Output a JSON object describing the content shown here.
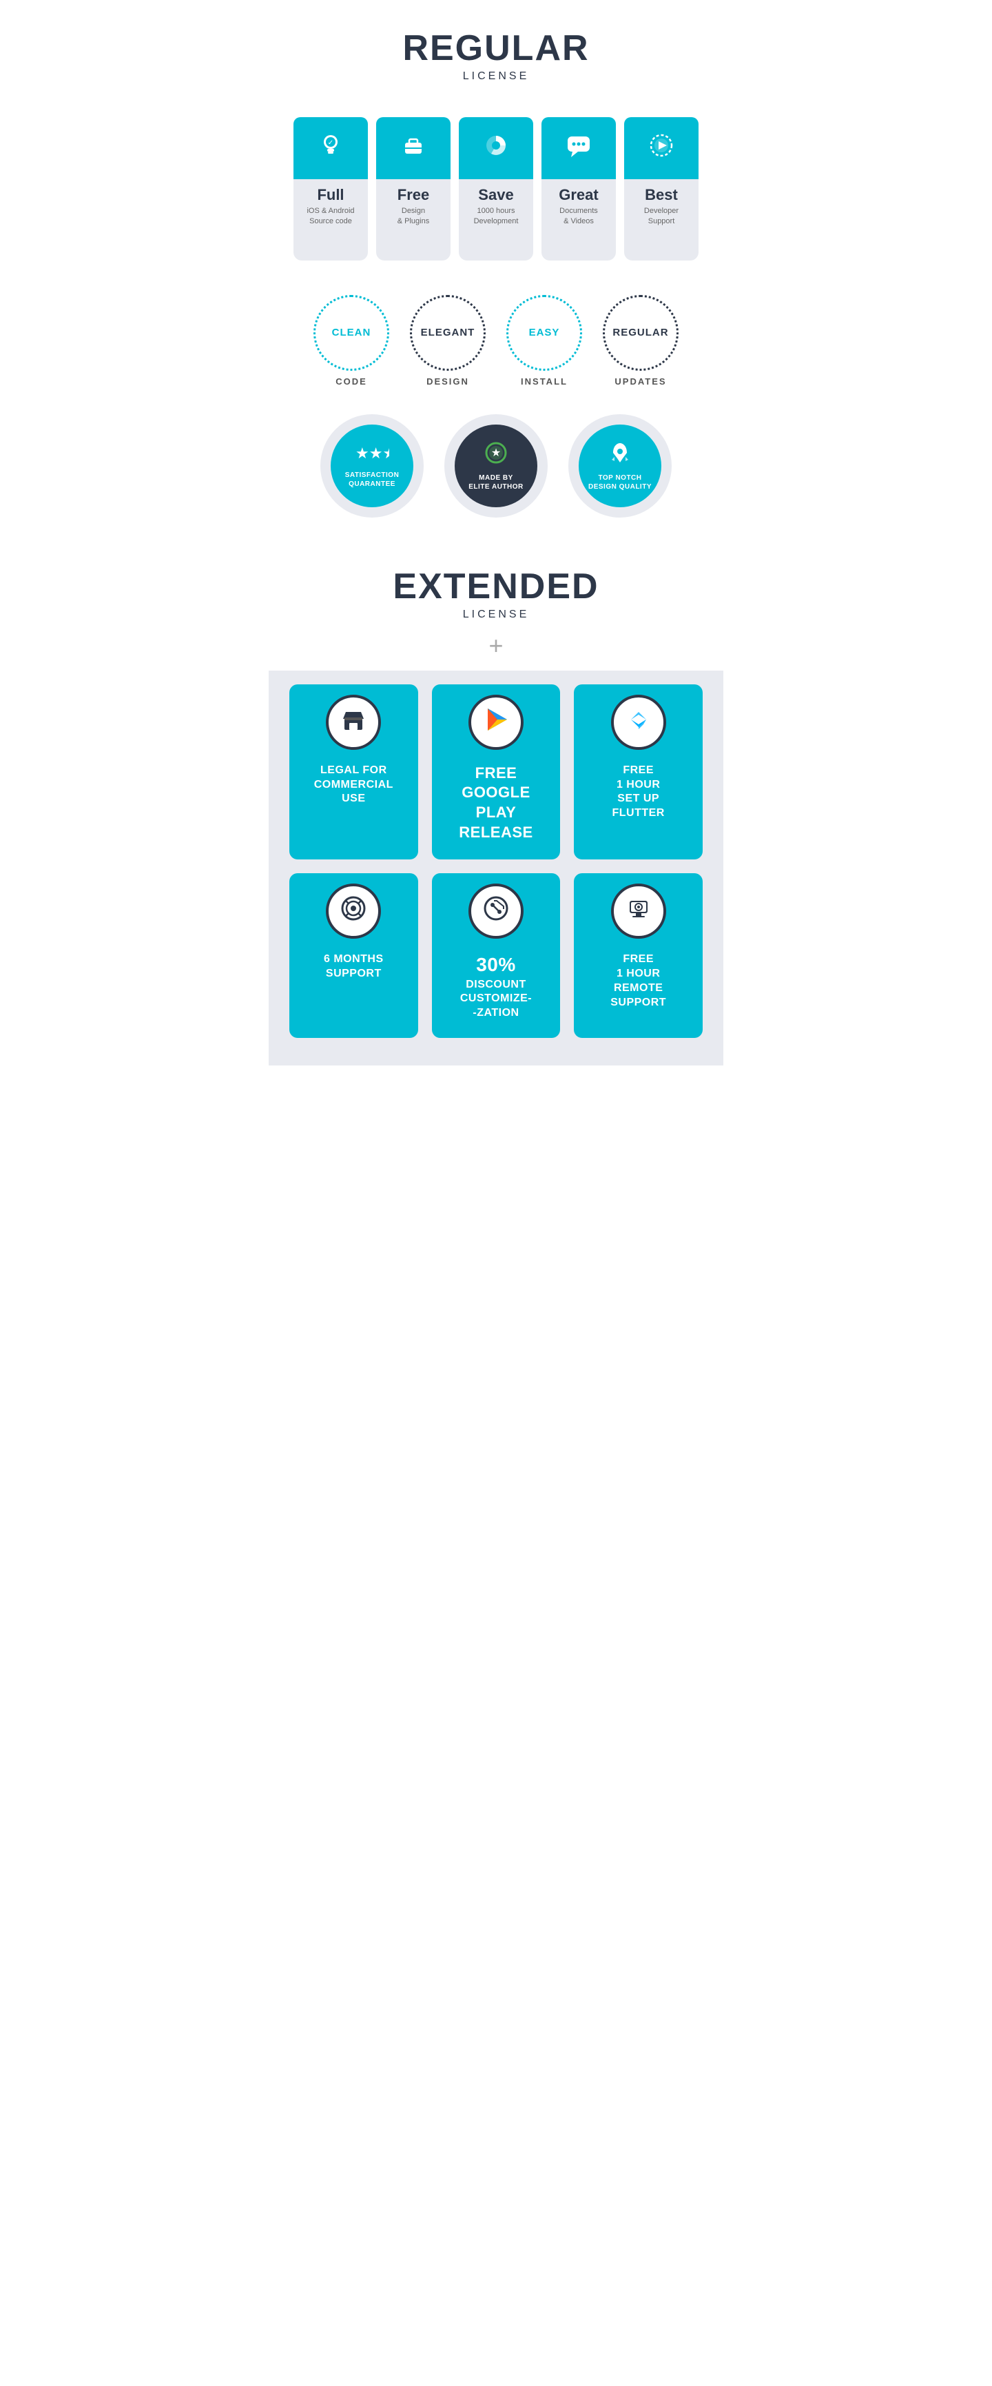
{
  "regular": {
    "title": "REGULAR",
    "subtitle": "LICENSE",
    "feature_cards": [
      {
        "id": "full",
        "title": "Full",
        "desc": "iOS & Android\nSource code",
        "icon": "bulb"
      },
      {
        "id": "free",
        "title": "Free",
        "desc": "Design\n& Plugins",
        "icon": "briefcase"
      },
      {
        "id": "save",
        "title": "Save",
        "desc": "1000 hours\nDevelopment",
        "icon": "chart"
      },
      {
        "id": "great",
        "title": "Great",
        "desc": "Documents\n& Videos",
        "icon": "chat"
      },
      {
        "id": "best",
        "title": "Best",
        "desc": "Developer\nSupport",
        "icon": "play"
      }
    ],
    "circles": [
      {
        "label": "CLEAN",
        "sub": "CODE",
        "dark": false
      },
      {
        "label": "ELEGANT",
        "sub": "DESIGN",
        "dark": true
      },
      {
        "label": "EASY",
        "sub": "INSTALL",
        "dark": false
      },
      {
        "label": "REGULAR",
        "sub": "UPDATES",
        "dark": true
      }
    ],
    "badges": [
      {
        "label": "SATISFACTION\nQUARANTEE",
        "icon": "stars",
        "dark": false
      },
      {
        "label": "MADE BY\nELITE AUTHOR",
        "icon": "medal",
        "dark": true
      },
      {
        "label": "TOP NOTCH\nDESIGN QUALITY",
        "icon": "rocket",
        "dark": false
      }
    ]
  },
  "extended": {
    "title": "EXTENDED",
    "subtitle": "LICENSE",
    "plus": "+",
    "cards": [
      {
        "id": "commercial",
        "icon": "store",
        "title": "LEGAL FOR\nCOMMERCIAL\nUSE",
        "big": false
      },
      {
        "id": "google-play",
        "icon": "gplay",
        "title": "FREE\nGOOGLE\nPLAY\nRELEASE",
        "big": true
      },
      {
        "id": "flutter",
        "icon": "flutter",
        "title": "FREE\n1 HOUR\nSET UP\nFLUTTER",
        "big": false
      },
      {
        "id": "support",
        "icon": "support",
        "title": "6 MONTHS\nSUPPORT",
        "big": false
      },
      {
        "id": "discount",
        "icon": "discount",
        "title": "30%\nDISCOUNT\nCUSTOMIZE-\n-ZATION",
        "big": true
      },
      {
        "id": "remote",
        "icon": "remote",
        "title": "FREE\n1 HOUR\nREMOTE\nSUPPORT",
        "big": false
      }
    ]
  }
}
